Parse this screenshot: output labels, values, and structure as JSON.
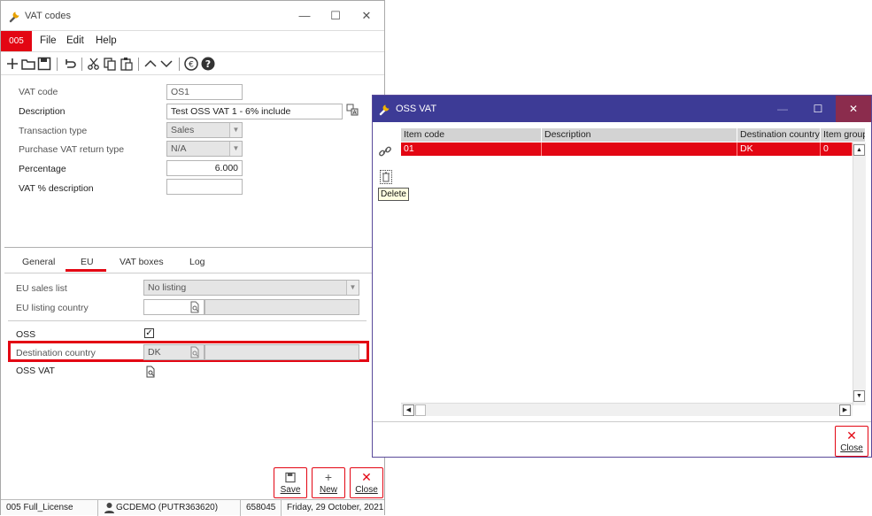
{
  "main_window": {
    "title": "VAT codes",
    "company_badge": "005",
    "menu": {
      "file": "File",
      "edit": "Edit",
      "help": "Help"
    },
    "fields": {
      "vat_code": {
        "label": "VAT code",
        "value": "OS1"
      },
      "description": {
        "label": "Description",
        "value": "Test OSS VAT 1 - 6% include"
      },
      "transaction_type": {
        "label": "Transaction type",
        "value": "Sales"
      },
      "purchase_vat_return_type": {
        "label": "Purchase VAT return type",
        "value": "N/A"
      },
      "percentage": {
        "label": "Percentage",
        "value": "6.000"
      },
      "vat_pct_description": {
        "label": "VAT % description",
        "value": ""
      }
    },
    "tabs": [
      "General",
      "EU",
      "VAT boxes",
      "Log"
    ],
    "active_tab": "EU",
    "eu": {
      "eu_sales_list": {
        "label": "EU sales list",
        "value": "No listing"
      },
      "eu_listing_country": {
        "label": "EU listing country",
        "value": ""
      },
      "oss": {
        "label": "OSS",
        "checked": true,
        "mark": "✓"
      },
      "destination_country": {
        "label": "Destination country",
        "value": "DK"
      },
      "oss_vat": {
        "label": "OSS VAT"
      }
    },
    "actions": {
      "save": "Save",
      "new": "New",
      "close": "Close"
    },
    "status_bar": {
      "license": "005 Full_License",
      "user": "GCDEMO (PUTR363620)",
      "number": "658045",
      "date": "Friday, 29 October, 2021"
    }
  },
  "oss_window": {
    "title": "OSS VAT",
    "columns": [
      "Item code",
      "Description",
      "Destination country",
      "Item group"
    ],
    "rows": [
      {
        "item_code": "01",
        "description": "",
        "destination_country": "DK",
        "item_group": "0"
      }
    ],
    "tooltip": "Delete",
    "close_label": "Close"
  },
  "colors": {
    "accent": "#e30613",
    "oss_titlebar": "#3d3b96",
    "oss_close": "#8b2c4d"
  }
}
